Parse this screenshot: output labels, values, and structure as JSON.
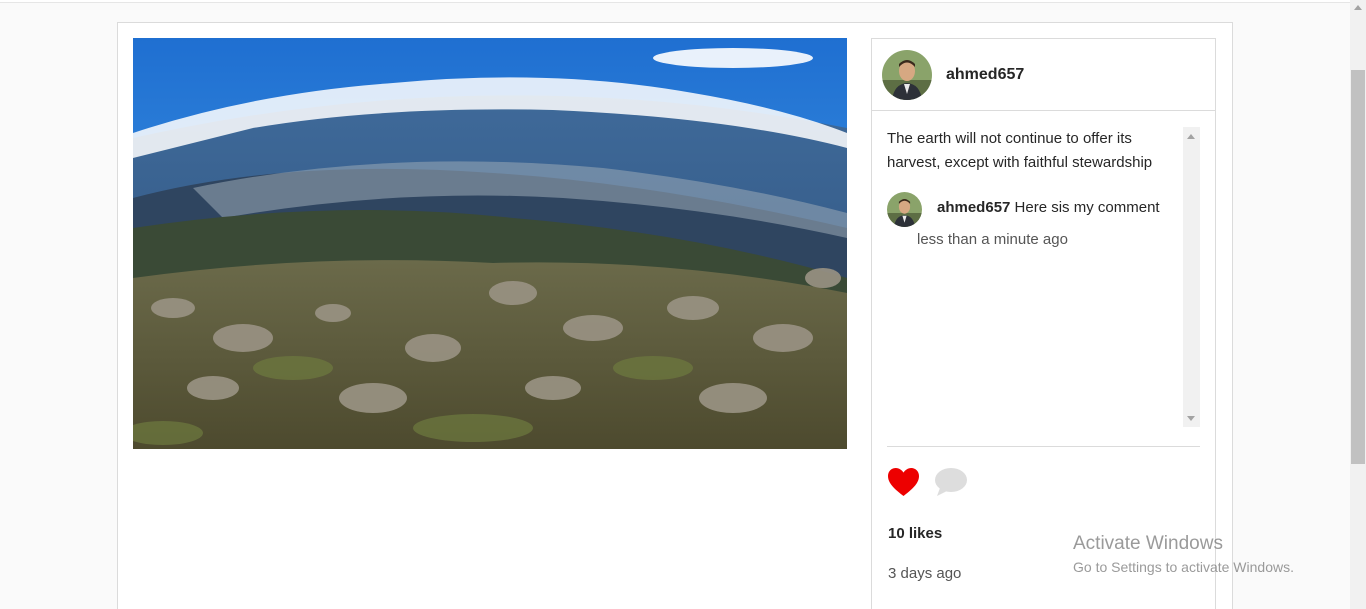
{
  "post": {
    "image_alt": "mountain landscape",
    "username": "ahmed657",
    "caption": "The earth will not continue to offer its harvest, except with faithful stewardship",
    "comments": [
      {
        "username": "ahmed657",
        "text": "Here sis my comment",
        "time": "less than a minute ago"
      }
    ],
    "likes": "10 likes",
    "time": "3 days ago"
  },
  "icons": {
    "like": "heart-icon",
    "comment": "comment-bubble-icon"
  },
  "colors": {
    "like": "#ed0000",
    "comment_icon": "#dddddd",
    "border": "#dbdbdb"
  },
  "watermark": {
    "line1": "Activate Windows",
    "line2": "Go to Settings to activate Windows."
  }
}
